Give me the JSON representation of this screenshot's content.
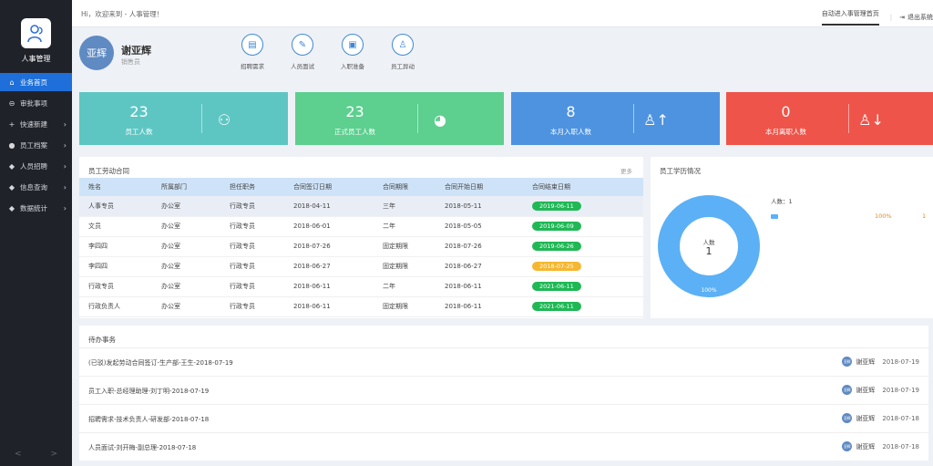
{
  "sidebar": {
    "app_name": "人事管理",
    "items": [
      {
        "label": "业务首页",
        "icon": "home-icon",
        "has_arrow": false,
        "active": true
      },
      {
        "label": "审批事项",
        "icon": "approve-icon",
        "has_arrow": false,
        "active": false
      },
      {
        "label": "快速新建",
        "icon": "plus-icon",
        "has_arrow": true,
        "active": false
      },
      {
        "label": "员工档案",
        "icon": "archive-icon",
        "has_arrow": true,
        "active": false
      },
      {
        "label": "人员招聘",
        "icon": "recruit-icon",
        "has_arrow": true,
        "active": false
      },
      {
        "label": "信息查询",
        "icon": "query-icon",
        "has_arrow": true,
        "active": false
      },
      {
        "label": "数据统计",
        "icon": "stats-icon",
        "has_arrow": true,
        "active": false
      }
    ],
    "footer_left": "<",
    "footer_right": ">"
  },
  "header": {
    "greeting": "Hi，欢迎来到 - 人事管理！",
    "switch_link": "自动进入事管理首页",
    "separator": "|",
    "logout": "退出系统"
  },
  "profile": {
    "avatar_text": "亚辉",
    "name": "谢亚辉",
    "role": "销售员"
  },
  "quick_actions": [
    {
      "label": "招聘需求",
      "icon": "doc-icon"
    },
    {
      "label": "人员面试",
      "icon": "interview-icon"
    },
    {
      "label": "入职准备",
      "icon": "onboard-icon"
    },
    {
      "label": "员工异动",
      "icon": "transfer-icon"
    }
  ],
  "stats": [
    {
      "value": "23",
      "label": "员工人数",
      "color": "#5ec6c2",
      "icon": "group-icon"
    },
    {
      "value": "23",
      "label": "正式员工人数",
      "color": "#5dcf8f",
      "icon": "pie-icon"
    },
    {
      "value": "8",
      "label": "本月入职人数",
      "color": "#4e93e0",
      "icon": "user-up-icon"
    },
    {
      "value": "0",
      "label": "本月离职人数",
      "color": "#ee5449",
      "icon": "user-down-icon"
    }
  ],
  "contracts": {
    "title": "员工劳动合同",
    "more": "更多",
    "headers": [
      "姓名",
      "所属部门",
      "担任职务",
      "合同签订日期",
      "合同期限",
      "合同开始日期",
      "合同结束日期"
    ],
    "rows": [
      {
        "cells": [
          "人事专员",
          "办公室",
          "行政专员",
          "2018-04-11",
          "三年",
          "2018-05-11"
        ],
        "end": "2019-06-11",
        "tag_color": "#1fb855"
      },
      {
        "cells": [
          "文员",
          "办公室",
          "行政专员",
          "2018-06-01",
          "二年",
          "2018-05-05"
        ],
        "end": "2019-06-09",
        "tag_color": "#1fb855"
      },
      {
        "cells": [
          "李四四",
          "办公室",
          "行政专员",
          "2018-07-26",
          "固定期限",
          "2018-07-26"
        ],
        "end": "2019-06-26",
        "tag_color": "#1fb855"
      },
      {
        "cells": [
          "李四四",
          "办公室",
          "行政专员",
          "2018-06-27",
          "固定期限",
          "2018-06-27"
        ],
        "end": "2018-07-25",
        "tag_color": "#f5b731"
      },
      {
        "cells": [
          "行政专员",
          "办公室",
          "行政专员",
          "2018-06-11",
          "二年",
          "2018-06-11"
        ],
        "end": "2021-06-11",
        "tag_color": "#1fb855"
      },
      {
        "cells": [
          "行政负责人",
          "办公室",
          "行政专员",
          "2018-06-11",
          "固定期限",
          "2018-06-11"
        ],
        "end": "2021-06-11",
        "tag_color": "#1fb855"
      }
    ]
  },
  "education": {
    "title": "员工学历情况",
    "legend_label": "人数：1",
    "legend_percent": "100%",
    "legend_count": "1",
    "center_label": "人数",
    "center_value": "1",
    "slice_label": "100%",
    "color": "#5cb0f5"
  },
  "todo": {
    "title": "待办事务",
    "items": [
      {
        "text": "(已驳)发起劳动合同签订-生产部-王生-2018-07-19",
        "avatar": "亚辉",
        "user": "谢亚辉",
        "date": "2018-07-19"
      },
      {
        "text": "员工入职-总经理助理-刘丁明-2018-07-19",
        "avatar": "亚辉",
        "user": "谢亚辉",
        "date": "2018-07-19"
      },
      {
        "text": "招聘需求-技术负责人-研发部-2018-07-18",
        "avatar": "亚辉",
        "user": "谢亚辉",
        "date": "2018-07-18"
      },
      {
        "text": "人员面试-刘开梅-副总理-2018-07-18",
        "avatar": "亚辉",
        "user": "谢亚辉",
        "date": "2018-07-18"
      }
    ]
  }
}
